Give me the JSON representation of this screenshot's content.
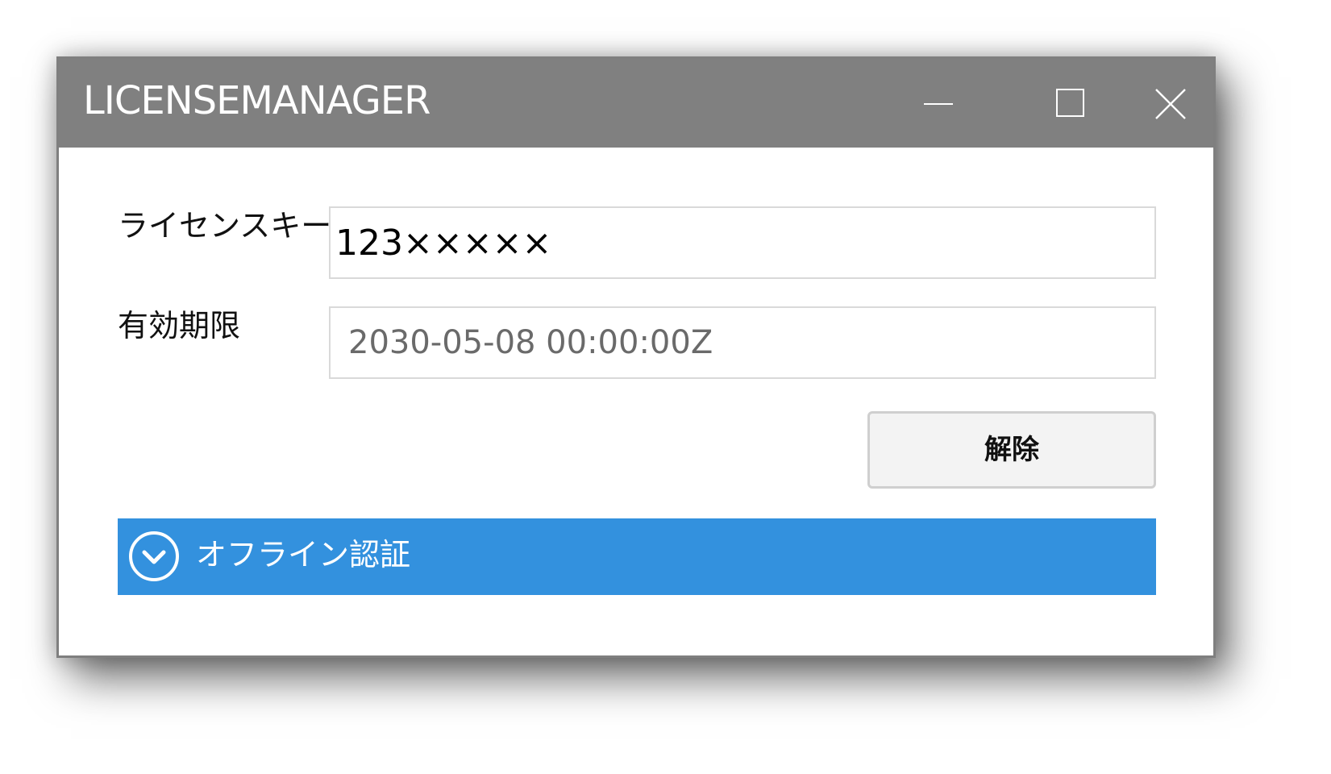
{
  "window": {
    "title": "LICENSEMANAGER",
    "controls": {
      "minimize": "minimize-icon",
      "maximize": "maximize-icon",
      "close": "close-icon"
    }
  },
  "form": {
    "license_key": {
      "label": "ライセンスキー",
      "value": "123×××××"
    },
    "expiry": {
      "label": "有効期限",
      "value": "2030-05-08 00:00:00Z"
    },
    "unlock_button": "解除"
  },
  "offline": {
    "icon": "chevron-down-circle-icon",
    "label": "オフライン認証"
  },
  "colors": {
    "titlebar": "#808080",
    "accent": "#3391DE"
  }
}
